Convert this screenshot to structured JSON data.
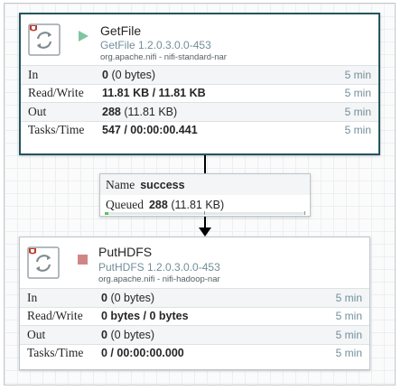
{
  "processors": [
    {
      "name": "GetFile",
      "type": "GetFile 1.2.0.3.0.0-453",
      "bundle": "org.apache.nifi - nifi-standard-nar",
      "run_state": "running",
      "run_state_color": "#7dc7a0",
      "stats": [
        {
          "label": "In",
          "value": "0",
          "detail": "(0 bytes)",
          "period": "5 min"
        },
        {
          "label": "Read/Write",
          "value": "11.81 KB / 11.81 KB",
          "detail": "",
          "period": "5 min"
        },
        {
          "label": "Out",
          "value": "288",
          "detail": "(11.81 KB)",
          "period": "5 min"
        },
        {
          "label": "Tasks/Time",
          "value": "547 / 00:00:00.441",
          "detail": "",
          "period": "5 min"
        }
      ]
    },
    {
      "name": "PutHDFS",
      "type": "PutHDFS 1.2.0.3.0.0-453",
      "bundle": "org.apache.nifi - nifi-hadoop-nar",
      "run_state": "stopped",
      "run_state_color": "#d18686",
      "stats": [
        {
          "label": "In",
          "value": "0",
          "detail": "(0 bytes)",
          "period": "5 min"
        },
        {
          "label": "Read/Write",
          "value": "0 bytes / 0 bytes",
          "detail": "",
          "period": "5 min"
        },
        {
          "label": "Out",
          "value": "0",
          "detail": "(0 bytes)",
          "period": "5 min"
        },
        {
          "label": "Tasks/Time",
          "value": "0 / 00:00:00.000",
          "detail": "",
          "period": "5 min"
        }
      ]
    }
  ],
  "connection": {
    "name_label": "Name",
    "name": "success",
    "queued_label": "Queued",
    "queued_count": "288",
    "queued_size": "(11.81 KB)",
    "queue_fill_fraction": 0.02
  },
  "colors": {
    "selected_border": "#22565f",
    "type_text": "#728e9b",
    "queue_fill": "#5bc25e"
  },
  "icons": {
    "processor_icon": "processor-cycle-icon",
    "running": "play-icon",
    "stopped": "stop-icon",
    "arrow": "arrow-down-icon"
  }
}
